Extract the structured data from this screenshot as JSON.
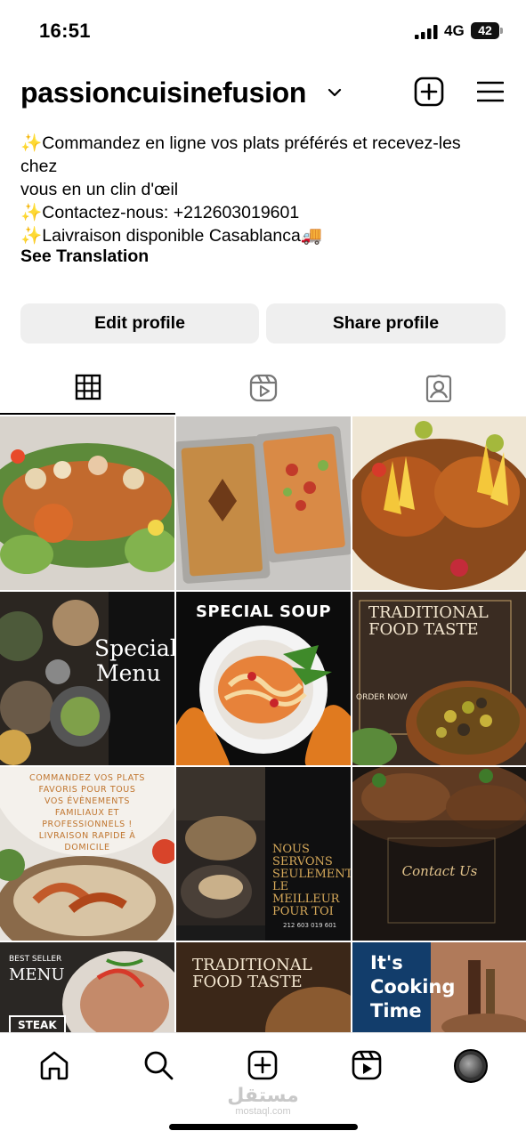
{
  "status": {
    "time": "16:51",
    "network": "4G",
    "battery": "42"
  },
  "profile": {
    "username": "passioncuisinefusion"
  },
  "bio": {
    "lines": [
      "✨Commandez en ligne vos plats préférés et recevez-les",
      "chez",
      "vous en un clin d'œil",
      "✨Contactez-nous: +212603019601",
      "✨Laivraison disponible Casablanca🚚"
    ],
    "see_translation": "See Translation"
  },
  "buttons": {
    "edit": "Edit profile",
    "share": "Share profile"
  },
  "tabs": [
    {
      "icon": "grid-icon",
      "active": true
    },
    {
      "icon": "reels-icon",
      "active": false
    },
    {
      "icon": "tagged-icon",
      "active": false
    }
  ],
  "posts": [
    {
      "kind": "photo",
      "alt": "",
      "text": []
    },
    {
      "kind": "photo",
      "alt": "",
      "text": []
    },
    {
      "kind": "photo",
      "alt": "",
      "text": []
    },
    {
      "kind": "graphic",
      "text": [
        "Special",
        "Menu"
      ]
    },
    {
      "kind": "graphic",
      "text": [
        "SPECIAL SOUP"
      ]
    },
    {
      "kind": "graphic",
      "text": [
        "TRADITIONAL",
        "FOOD TASTE",
        "ORDER NOW"
      ]
    },
    {
      "kind": "graphic",
      "text": [
        "COMMANDEZ VOS PLATS",
        "FAVORIS POUR TOUS",
        "VOS ÉVÈNEMENTS",
        "FAMILIAUX ET",
        "PROFESSIONNELS !",
        "LIVRAISON RAPIDE À",
        "DOMICILE"
      ]
    },
    {
      "kind": "graphic",
      "text": [
        "NOUS",
        "SERVONS",
        "SEULEMENT",
        "LE MEILLEUR",
        "POUR TOI",
        "212 603 019 601"
      ]
    },
    {
      "kind": "graphic",
      "text": [
        "Contact Us"
      ]
    },
    {
      "kind": "graphic",
      "text": [
        "BEST SELLER",
        "MENU",
        "STEAK"
      ]
    },
    {
      "kind": "graphic",
      "text": [
        "TRADITIONAL",
        "FOOD TASTE"
      ]
    },
    {
      "kind": "graphic",
      "text": [
        "It's",
        "Cooking",
        "Time"
      ]
    }
  ],
  "watermark": {
    "arabic": "مستقل",
    "latin": "mostaql.com"
  },
  "colors": {
    "button_bg": "#efefef",
    "accent_gold": "#c8a46a"
  }
}
